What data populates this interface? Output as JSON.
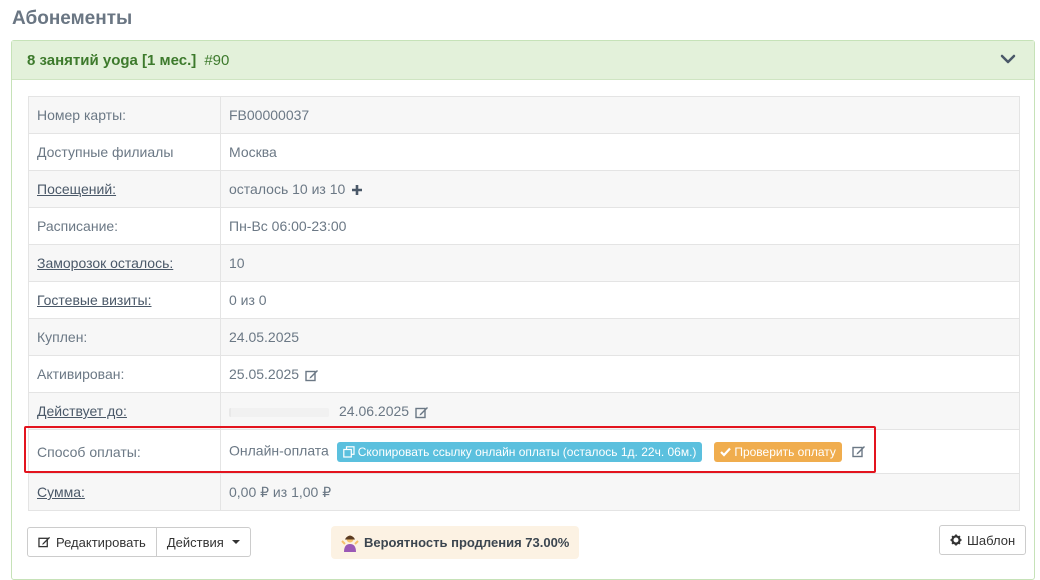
{
  "page": {
    "title": "Абонементы"
  },
  "panel": {
    "name": "8 занятий yoga [1 мес.]",
    "number": "#90"
  },
  "rows": [
    {
      "label": "Номер карты:",
      "value": "FB00000037"
    },
    {
      "label": "Доступные филиалы",
      "value": "Москва"
    },
    {
      "label": "Посещений:",
      "value": "осталось 10 из 10"
    },
    {
      "label": "Расписание:",
      "value": "Пн-Вс 06:00-23:00"
    },
    {
      "label": "Заморозок осталось:",
      "value": "10"
    },
    {
      "label": "Гостевые визиты:",
      "value": "0 из 0"
    },
    {
      "label": "Куплен:",
      "value": "24.05.2025"
    },
    {
      "label": "Активирован:",
      "value": "25.05.2025"
    },
    {
      "label": "Действует до:",
      "value": "24.06.2025",
      "progress": 0.02
    },
    {
      "label": "Способ оплаты:",
      "value": "Онлайн-оплата",
      "copy_button": "Скопировать ссылку онлайн оплаты (осталось 1д. 22ч. 06м.)",
      "check_button": "Проверить оплату"
    },
    {
      "label": "Сумма:",
      "value": "0,00 ₽ из 1,00 ₽"
    }
  ],
  "footer": {
    "edit_button": "Редактировать",
    "actions_button": "Действия",
    "probability": "Вероятность продления 73.00%",
    "template_button": "Шаблон"
  },
  "colors": {
    "header_bg": "#e3f1da",
    "header_text": "#3d7a2c",
    "info_button": "#5bc0de",
    "warning_button": "#f0ad4e",
    "highlight": "#e3141e",
    "amount_red": "#e0463a"
  },
  "icons": [
    "chevron-down-icon",
    "plus-icon",
    "edit-icon",
    "copy-icon",
    "check-icon",
    "pencil-square-icon",
    "gear-icon",
    "caret-down-icon",
    "shrug-emoji-icon"
  ]
}
